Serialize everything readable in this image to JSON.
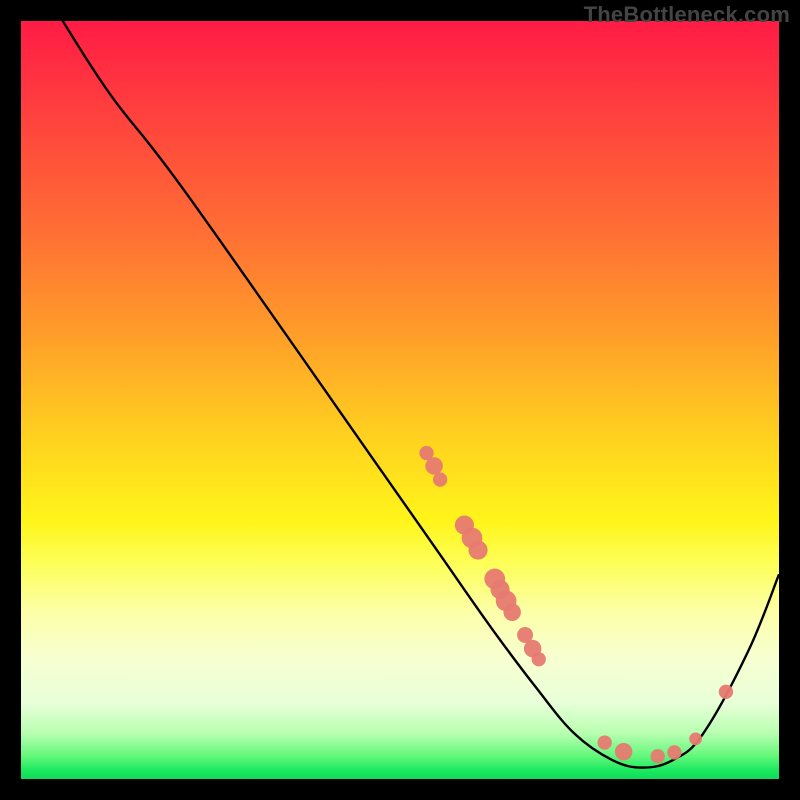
{
  "watermark": "TheBottleneck.com",
  "chart_data": {
    "type": "line",
    "title": "",
    "xlabel": "",
    "ylabel": "",
    "xlim": [
      0,
      100
    ],
    "ylim": [
      0,
      100
    ],
    "curve": [
      {
        "x": 5.5,
        "y": 100
      },
      {
        "x": 12,
        "y": 90
      },
      {
        "x": 22,
        "y": 77
      },
      {
        "x": 48,
        "y": 40
      },
      {
        "x": 55,
        "y": 30
      },
      {
        "x": 62,
        "y": 20
      },
      {
        "x": 68,
        "y": 12
      },
      {
        "x": 73,
        "y": 6
      },
      {
        "x": 78,
        "y": 2.5
      },
      {
        "x": 82,
        "y": 1.5
      },
      {
        "x": 86,
        "y": 2.5
      },
      {
        "x": 90,
        "y": 6
      },
      {
        "x": 96,
        "y": 17
      },
      {
        "x": 100,
        "y": 27
      }
    ],
    "marker_clusters": [
      {
        "cx": 53.5,
        "cy": 43,
        "r": 0.9
      },
      {
        "cx": 54.5,
        "cy": 41.3,
        "r": 1.1
      },
      {
        "cx": 55.3,
        "cy": 39.5,
        "r": 0.9
      },
      {
        "cx": 58.5,
        "cy": 33.5,
        "r": 1.2
      },
      {
        "cx": 59.5,
        "cy": 31.8,
        "r": 1.3
      },
      {
        "cx": 60.3,
        "cy": 30.2,
        "r": 1.2
      },
      {
        "cx": 62.5,
        "cy": 26.4,
        "r": 1.3
      },
      {
        "cx": 63.2,
        "cy": 25.0,
        "r": 1.2
      },
      {
        "cx": 64.0,
        "cy": 23.5,
        "r": 1.3
      },
      {
        "cx": 64.8,
        "cy": 22.0,
        "r": 1.1
      },
      {
        "cx": 66.5,
        "cy": 19.0,
        "r": 1.0
      },
      {
        "cx": 67.5,
        "cy": 17.2,
        "r": 1.1
      },
      {
        "cx": 68.3,
        "cy": 15.8,
        "r": 0.9
      },
      {
        "cx": 77.0,
        "cy": 4.8,
        "r": 0.9
      },
      {
        "cx": 79.5,
        "cy": 3.6,
        "r": 1.1
      },
      {
        "cx": 84.0,
        "cy": 3.0,
        "r": 0.9
      },
      {
        "cx": 86.2,
        "cy": 3.5,
        "r": 0.9
      },
      {
        "cx": 89.0,
        "cy": 5.3,
        "r": 0.8
      },
      {
        "cx": 93.0,
        "cy": 11.5,
        "r": 0.9
      }
    ],
    "marker_color": "#e77a71",
    "curve_color": "#000000",
    "curve_width": 2.4
  }
}
